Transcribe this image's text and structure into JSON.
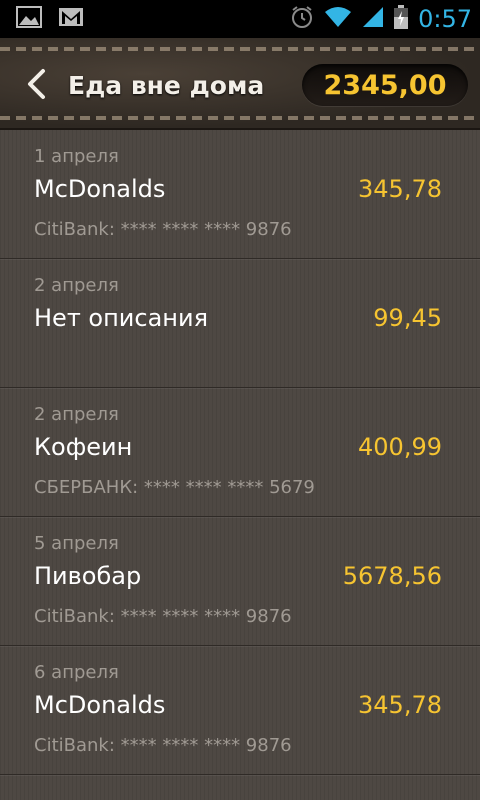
{
  "status_bar": {
    "time": "0:57",
    "icons": [
      "image-icon",
      "gmail-icon",
      "alarm-icon",
      "wifi-icon",
      "signal-icon",
      "battery-charging-icon"
    ]
  },
  "header": {
    "title": "Еда вне дома",
    "total": "2345,00"
  },
  "colors": {
    "accent": "#f6c431",
    "time": "#33b5e5"
  },
  "transactions": [
    {
      "date": "1 апреля",
      "name": "McDonalds",
      "amount": "345,78",
      "account": "CitiBank: **** **** **** 9876"
    },
    {
      "date": "2 апреля",
      "name": "Нет описания",
      "amount": "99,45",
      "account": ""
    },
    {
      "date": "2 апреля",
      "name": "Кофеин",
      "amount": "400,99",
      "account": "СБЕРБАНК: **** **** **** 5679"
    },
    {
      "date": "5 апреля",
      "name": "Пивобар",
      "amount": "5678,56",
      "account": "CitiBank: **** **** **** 9876"
    },
    {
      "date": "6 апреля",
      "name": "McDonalds",
      "amount": "345,78",
      "account": "CitiBank: **** **** **** 9876"
    }
  ]
}
